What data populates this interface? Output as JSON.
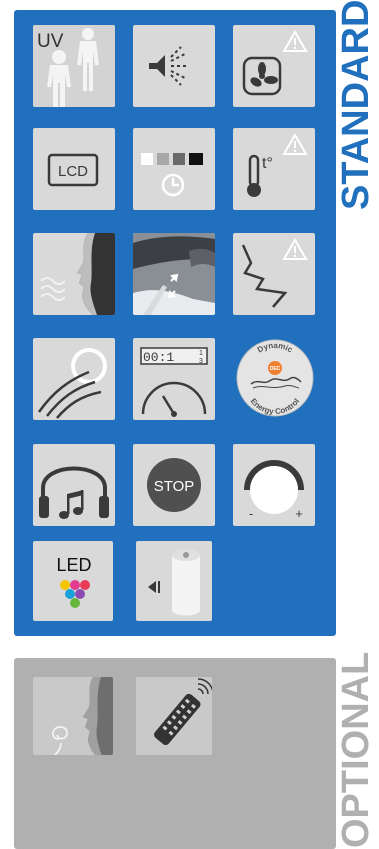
{
  "sections": {
    "standard_label": "STANDARD",
    "optional_label": "OPTIONAL"
  },
  "icons": {
    "uv_text": "UV",
    "lcd_text": "LCD",
    "display_digits": "00:1",
    "display_fraction_top": "1",
    "display_fraction_bottom": "3",
    "dec_top": "Dynamic",
    "dec_badge": "DEC",
    "dec_bottom": "Energy Control",
    "stop_text": "STOP",
    "minus_text": "-",
    "plus_text": "+",
    "led_text": "LED"
  },
  "colors": {
    "standard_blue": "#2070bd",
    "optional_gray": "#b0b0b0",
    "tile_gray": "#d9d9d9",
    "icon_dark": "#3a3a3a"
  }
}
